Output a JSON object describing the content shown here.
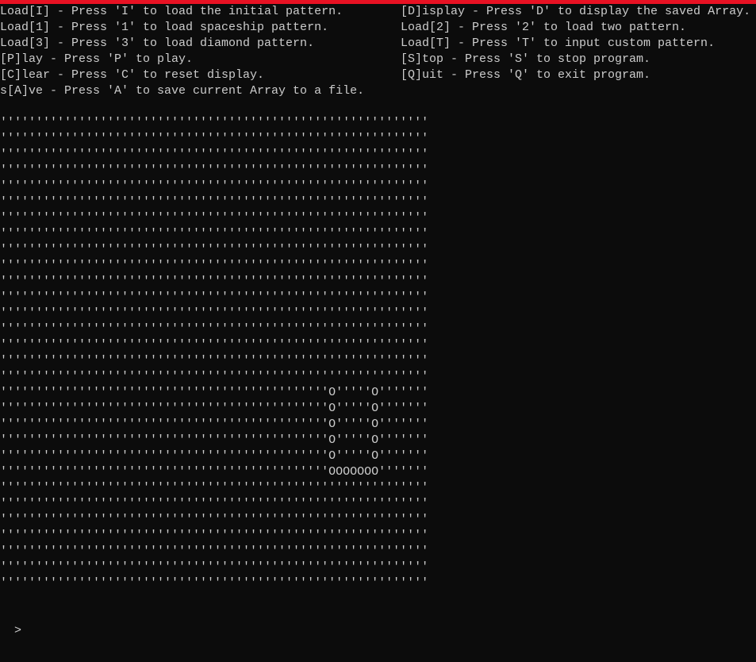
{
  "window": {
    "accent_color": "#e81123",
    "background_color": "#0c0c0c",
    "text_color": "#cccccc"
  },
  "menu": {
    "left": [
      "Load[I] - Press 'I' to load the initial pattern.",
      "Load[1] - Press '1' to load spaceship pattern.",
      "Load[3] - Press '3' to load diamond pattern.",
      "[P]lay - Press 'P' to play.",
      "[C]lear - Press 'C' to reset display.",
      "s[A]ve - Press 'A' to save current Array to a file."
    ],
    "right": [
      "[D]isplay - Press 'D' to display the saved Array.",
      "Load[2] - Press '2' to load two pattern.",
      "Load[T] - Press 'T' to input custom pattern.",
      "[S]top - Press 'S' to stop program.",
      "[Q]uit - Press 'Q' to exit program."
    ]
  },
  "grid": {
    "rows": 30,
    "cols": 60,
    "empty_char": "'",
    "live_char": "O",
    "live_cells": [
      [
        17,
        46
      ],
      [
        17,
        52
      ],
      [
        18,
        46
      ],
      [
        18,
        52
      ],
      [
        19,
        46
      ],
      [
        19,
        52
      ],
      [
        20,
        46
      ],
      [
        20,
        52
      ],
      [
        21,
        46
      ],
      [
        21,
        52
      ],
      [
        22,
        46
      ],
      [
        22,
        47
      ],
      [
        22,
        48
      ],
      [
        22,
        49
      ],
      [
        22,
        50
      ],
      [
        22,
        51
      ],
      [
        22,
        52
      ]
    ]
  },
  "prompt": {
    "symbol": ">"
  }
}
